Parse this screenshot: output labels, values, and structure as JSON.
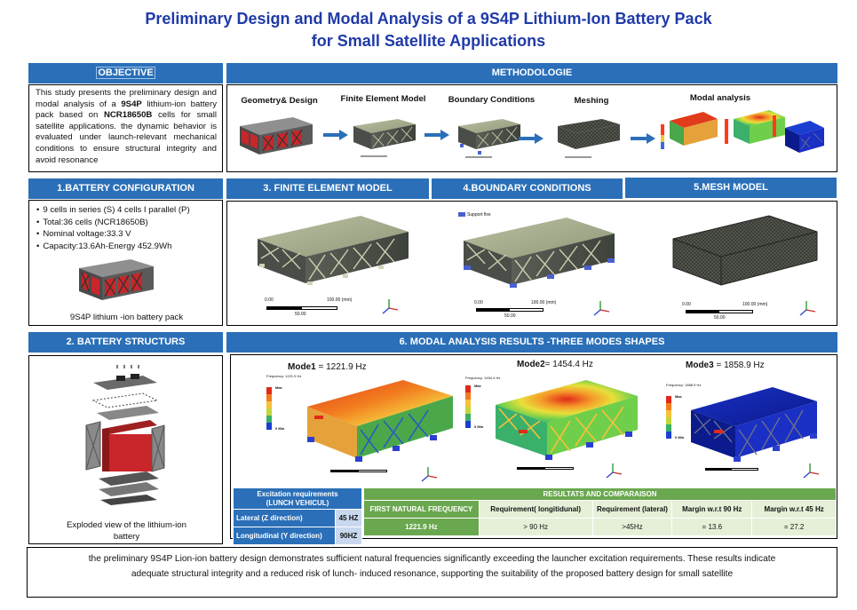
{
  "title": {
    "line1": "Preliminary Design and Modal Analysis of a 9S4P Lithium-Ion Battery Pack",
    "line2": "for Small Satellite Applications"
  },
  "objective": {
    "header": "OBJECTIVE",
    "text_runs": [
      "This study presents the preliminary design and modal analysis of a ",
      "9S4P",
      " lithium-ion battery pack based on ",
      "NCR18650B",
      " cells for small satellite applications. the dynamic behavior is evaluated under launch-relevant mechanical conditions to ensure structural integrity and avoid resonance"
    ]
  },
  "methodology": {
    "header": "METHODOLOGIE",
    "steps": [
      "Geometry& Design",
      "Finite Element Model",
      "Boundary Conditions",
      "Meshing",
      "Modal analysis"
    ]
  },
  "battery_config": {
    "header": "1.BATTERY CONFIGURATION",
    "items": [
      "9 cells in series (S) 4 cells I parallel (P)",
      "Total:36 cells (NCR18650B)",
      "Nominal voltage:33.3 V",
      "Capacity:13.6Ah-Energy 452.9Wh"
    ],
    "caption": "9S4P lithium -ion battery pack"
  },
  "fe_model": {
    "header": "3. FINITE ELEMENT MODEL",
    "scale_left": "0.00",
    "scale_mid": "100.00 (mm)",
    "scale_sub": "50.00"
  },
  "boundary": {
    "header": "4.BOUNDARY CONDITIONS",
    "legend": "Support fixe",
    "scale_left": "0.00",
    "scale_mid": "100.00 (mm)",
    "scale_sub": "50.00"
  },
  "mesh": {
    "header": "5.MESH MODEL",
    "scale_left": "0.00",
    "scale_mid": "100.00 (mm)",
    "scale_sub": "50.00"
  },
  "structure": {
    "header": "2. BATTERY STRUCTURS",
    "caption_line1": "Exploded view of the lithium-ion",
    "caption_line2": "battery"
  },
  "modal": {
    "header": "6. MODAL ANALYSIS RESULTS -THREE MODES SHAPES",
    "modes": [
      {
        "name": "Mode1",
        "value": "= 1221.9 Hz",
        "sub": "Frequency: 1221.9 Hz"
      },
      {
        "name": "Mode2",
        "value": "= 1454.4 Hz",
        "sub": "Frequency: 1454.4 Hz"
      },
      {
        "name": "Mode3",
        "value": "= 1858.9 Hz",
        "sub": "Frequency: 1858.9 Hz"
      }
    ],
    "legend_max": "Max",
    "legend_min": "0 Min"
  },
  "excitation": {
    "header_line1": "Excitation requirements",
    "header_line2": "(LUNCH VEHICUL)",
    "rows": [
      {
        "label": "Lateral (Z direction)",
        "value": "45 HZ"
      },
      {
        "label": "Longitudinal (Y direction)",
        "value": "90HZ"
      }
    ]
  },
  "results": {
    "header": "RESULTATS AND COMPARAISON",
    "columns": [
      "FIRST NATURAL FREQUENCY",
      "Requirement( longitidunal)",
      "Requirement (lateral)",
      "Margin w.r.t 90 Hz",
      "Margin w.r.t 45 Hz"
    ],
    "values": [
      "1221.9 Hz",
      "> 90 Hz",
      ">45Hz",
      "= 13.6",
      "= 27.2"
    ]
  },
  "conclusion": {
    "line1": "the preliminary 9S4P Lion-ion battery design demonstrates sufficient natural frequencies significantly exceeding the launcher excitation requirements. These results indicate",
    "line2": "adequate structural integrity and a reduced risk of lunch- induced resonance, supporting the suitability of the proposed battery design for small satellite"
  },
  "colors": {
    "title": "#1f3aa8",
    "header_blue": "#2a6fb8",
    "result_green": "#6aa84f",
    "cell_red": "#c8262a",
    "frame_gray": "#555555"
  }
}
